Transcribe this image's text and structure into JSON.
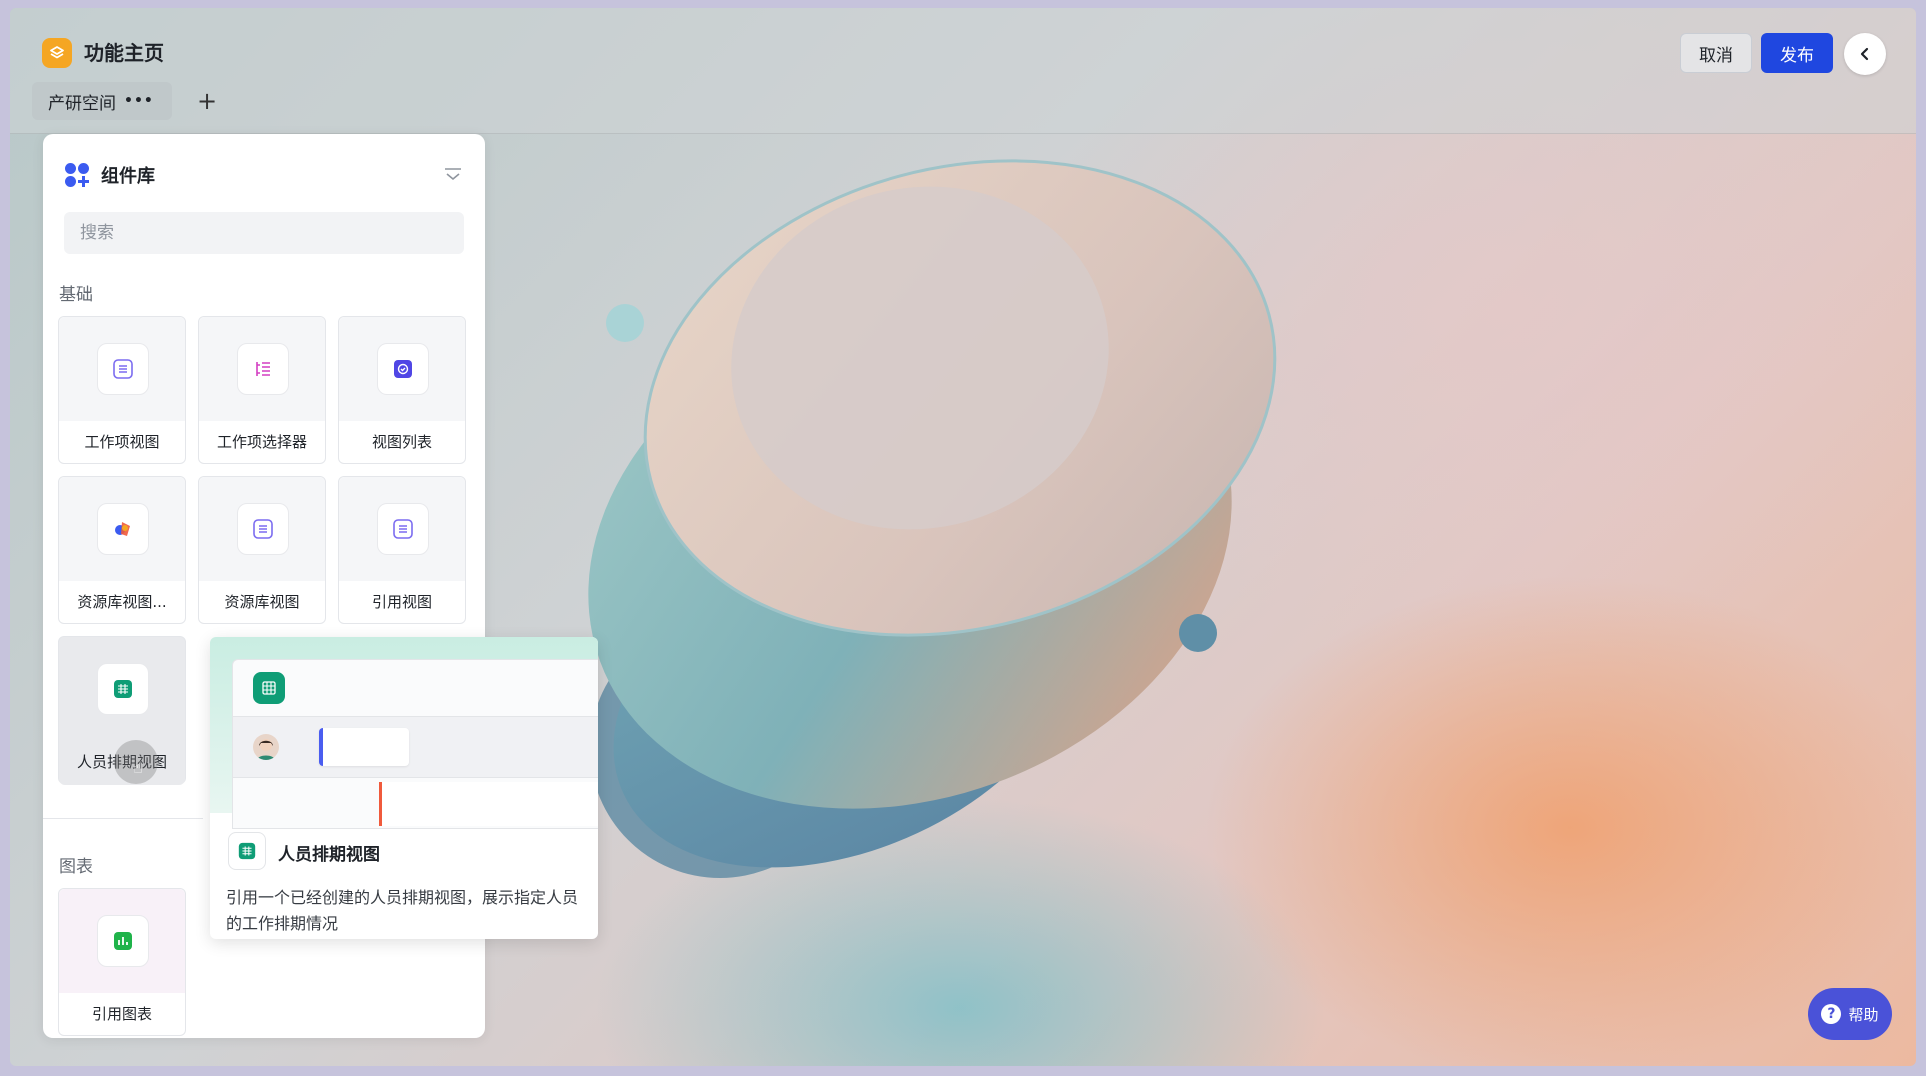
{
  "header": {
    "app_title": "功能主页",
    "logo_icon": "stack-icon",
    "tab_label": "产研空间",
    "tab_more": "•••",
    "tab_add": "+",
    "cancel_label": "取消",
    "publish_label": "发布",
    "back_icon": "chevron-left-icon"
  },
  "colors": {
    "accent": "#1f47e0",
    "logo": "#f5a623",
    "help": "#4a52d8",
    "green": "#0f9d76"
  },
  "panel": {
    "title": "组件库",
    "search_placeholder": "搜索",
    "sections": [
      {
        "label": "基础",
        "cards": [
          {
            "label": "工作项视图",
            "icon": "list-icon"
          },
          {
            "label": "工作项选择器",
            "icon": "tree-list-icon"
          },
          {
            "label": "视图列表",
            "icon": "check-badge-icon"
          },
          {
            "label": "资源库视图...",
            "icon": "shapes-icon"
          },
          {
            "label": "资源库视图",
            "icon": "list-icon"
          },
          {
            "label": "引用视图",
            "icon": "list-icon"
          },
          {
            "label": "人员排期视图",
            "icon": "grid-icon"
          }
        ]
      },
      {
        "label": "图表",
        "cards": [
          {
            "label": "引用图表",
            "icon": "bar-chart-icon"
          }
        ]
      }
    ]
  },
  "popup": {
    "title": "人员排期视图",
    "description": "引用一个已经创建的人员排期视图，展示指定人员的工作排期情况"
  },
  "help": {
    "label": "帮助",
    "icon_text": "?"
  }
}
